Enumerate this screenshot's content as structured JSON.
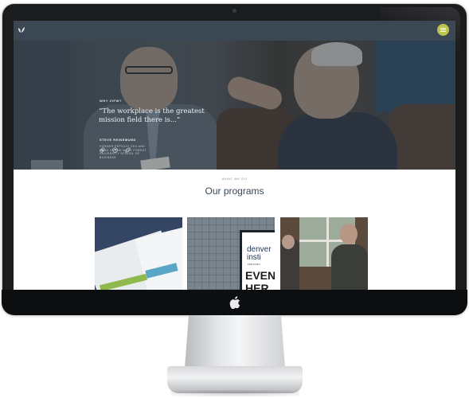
{
  "hero": {
    "eyebrow": "WHY ZIFW?",
    "quote": "“The workplace is the greatest mission field there is...”",
    "author": "STEVE REINEMUND",
    "author_title": "FORMER PEPSICO CEO AND DEAN OF THE WAKE FOREST UNIVERSITY SCHOOL OF BUSINESS",
    "icons": [
      "chain-icon",
      "badge-icon",
      "leaf-icon"
    ]
  },
  "programs": {
    "eyebrow": "WHAT WE DO",
    "title": "Our programs",
    "cards": [
      {
        "image": "brochures"
      },
      {
        "image": "denver-institute-event-sign",
        "sign_line1": "denver",
        "sign_line2": "insti",
        "sign_small": "FOR FAITH",
        "sign_big1": "EVEN",
        "sign_big2": "HER"
      },
      {
        "image": "people-talking"
      }
    ]
  },
  "colors": {
    "topbar": "#3b4752",
    "menu_button": "#b8c44c",
    "title_text": "#3b4752"
  }
}
